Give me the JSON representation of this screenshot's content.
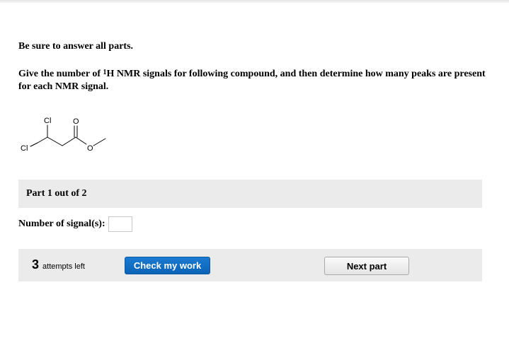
{
  "instructions": "Be sure to answer all parts.",
  "question": {
    "prefix": "Give the number of ",
    "isotope_superscript": "1",
    "isotope_rest": "H NMR signals for following compound, and then determine how many peaks are present for each NMR signal."
  },
  "molecule": {
    "atom_labels": {
      "chlorine_top": "Cl",
      "chlorine_left": "Cl",
      "oxygen_carbonyl": "O",
      "oxygen_ester": "O"
    }
  },
  "part": {
    "label": "Part 1 out of 2"
  },
  "signals_field": {
    "label": "Number of signal(s):",
    "value": ""
  },
  "actions": {
    "attempts_count": "3",
    "attempts_text": "attempts left",
    "check_label": "Check my work",
    "next_label": "Next part"
  },
  "colors": {
    "primary_button": "#0b63b6",
    "panel_background": "#ebebeb"
  }
}
